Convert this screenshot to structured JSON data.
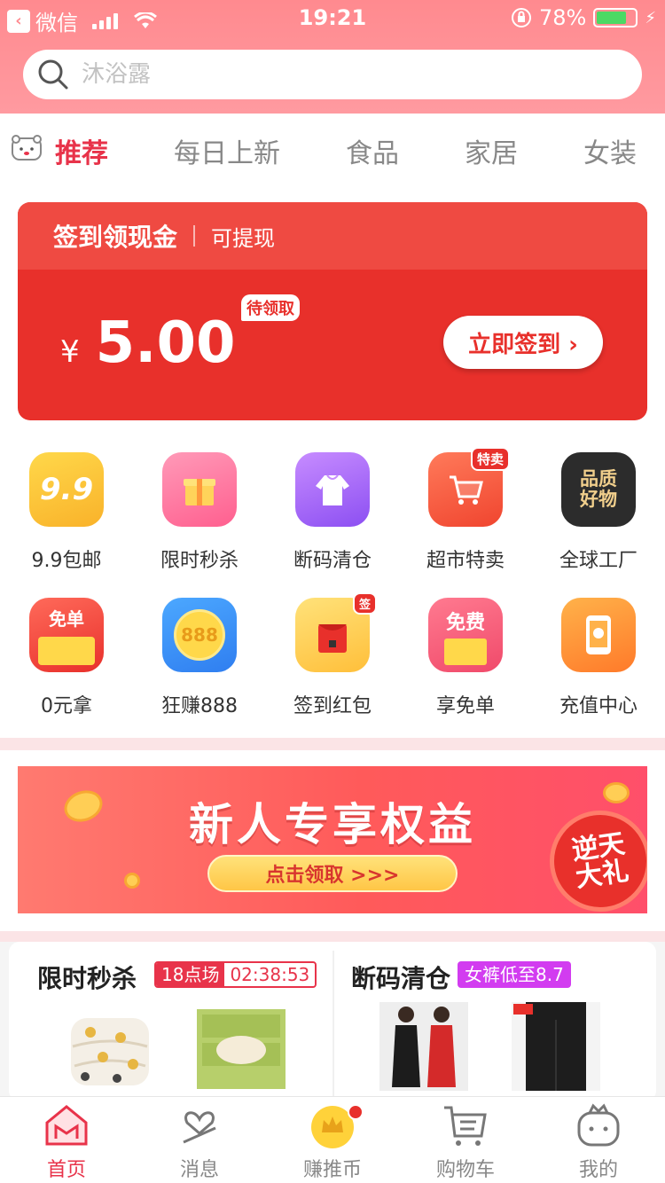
{
  "status_bar": {
    "back_app": "微信",
    "time": "19:21",
    "battery": "78%",
    "battery_level": 0.78
  },
  "search": {
    "placeholder": "沐浴露"
  },
  "tabs": [
    {
      "label": "推荐",
      "active": true
    },
    {
      "label": "每日上新"
    },
    {
      "label": "食品"
    },
    {
      "label": "家居"
    },
    {
      "label": "女装"
    }
  ],
  "sign_card": {
    "title": "签到领现金",
    "subtitle": "可提现",
    "currency": "¥",
    "amount": "5.00",
    "badge": "待领取",
    "button": "立即签到 ›"
  },
  "grid": [
    {
      "label": "9.9包邮",
      "icon": "9.9",
      "icon_name": "nine-nine-icon"
    },
    {
      "label": "限时秒杀",
      "icon": "",
      "icon_name": "gift-icon"
    },
    {
      "label": "断码清仓",
      "icon": "",
      "icon_name": "hoodie-icon"
    },
    {
      "label": "超市特卖",
      "icon": "",
      "icon_name": "cart-icon",
      "tag": "特卖"
    },
    {
      "label": "全球工厂",
      "icon": "品质\n好物",
      "icon_name": "quality-goods-icon"
    },
    {
      "label": "0元拿",
      "icon": "免单",
      "icon_name": "free-snack-icon"
    },
    {
      "label": "狂赚888",
      "icon": "888",
      "icon_name": "coin-888-icon"
    },
    {
      "label": "签到红包",
      "icon": "",
      "icon_name": "red-envelope-icon",
      "tag": "签"
    },
    {
      "label": "享免单",
      "icon": "免费",
      "icon_name": "free-gift-icon"
    },
    {
      "label": "充值中心",
      "icon": "",
      "icon_name": "phone-recharge-icon"
    }
  ],
  "banner": {
    "title": "新人专享权益",
    "button": "点击领取 >>>",
    "badge_line1": "逆天",
    "badge_line2": "大礼"
  },
  "promo": {
    "flash_title": "限时秒杀",
    "flash_session": "18点场",
    "flash_countdown": "02:38:53",
    "clearance_title": "断码清仓",
    "clearance_tag": "女裤低至8.7"
  },
  "tabbar": [
    {
      "label": "首页",
      "active": true
    },
    {
      "label": "消息"
    },
    {
      "label": "赚推币"
    },
    {
      "label": "购物车"
    },
    {
      "label": "我的"
    }
  ],
  "colors": {
    "accent": "#e8334a",
    "header": "#ff8a8f",
    "card": "#e8302b"
  }
}
